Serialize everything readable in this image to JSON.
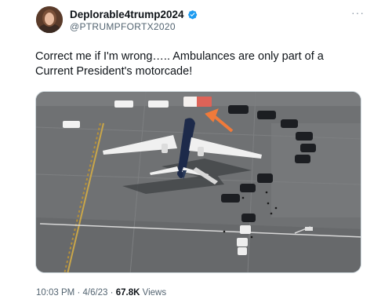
{
  "tweet": {
    "display_name": "Deplorable4trump2024",
    "handle": "@PTRUMPFORTX2020",
    "text": "Correct me if I'm wrong….. Ambulances are only part of a Current President's motorcade!",
    "time": "10:03 PM",
    "separator": "·",
    "date": "4/6/23",
    "views_count": "67.8K",
    "views_label": "Views"
  },
  "icons": {
    "verified": "verified-badge-icon",
    "more": "more-options-icon"
  },
  "colors": {
    "verified_blue": "#1d9bf0",
    "arrow_orange": "#f07a3a",
    "tarmac": "#6c6e70"
  }
}
